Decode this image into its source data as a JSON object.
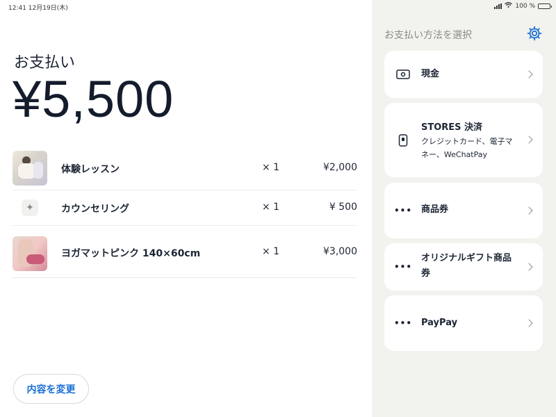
{
  "status_bar": {
    "time": "12:41 12月19日(木)",
    "battery": "100 %"
  },
  "payment": {
    "label": "お支払い",
    "total": "¥5,500"
  },
  "items": [
    {
      "name": "体験レッスン",
      "quantity": "× 1",
      "price": "¥2,000",
      "thumbnail": "image"
    },
    {
      "name": "カウンセリング",
      "quantity": "× 1",
      "price": "¥ 500",
      "thumbnail": "sparkle-icon"
    },
    {
      "name": "ヨガマットピンク 140×60cm",
      "quantity": "× 1",
      "price": "¥3,000",
      "thumbnail": "image"
    }
  ],
  "buttons": {
    "change": "内容を変更"
  },
  "payment_methods": {
    "title": "お支払い方法を選択",
    "settings_icon": "gear-icon",
    "options": [
      {
        "label": "現金",
        "icon": "cash-icon"
      },
      {
        "label": "STORES 決済",
        "subtitle": "クレジットカード、電子マネー、WeChatPay",
        "icon": "card-reader-icon"
      },
      {
        "label": "商品券",
        "icon": "ellipsis-icon"
      },
      {
        "label": "オリジナルギフト商品券",
        "icon": "ellipsis-icon"
      },
      {
        "label": "PayPay",
        "icon": "ellipsis-icon"
      }
    ]
  },
  "colors": {
    "accent": "#1a6fd6",
    "panel_bg": "#f2f2ee",
    "text": "#1c2434"
  }
}
